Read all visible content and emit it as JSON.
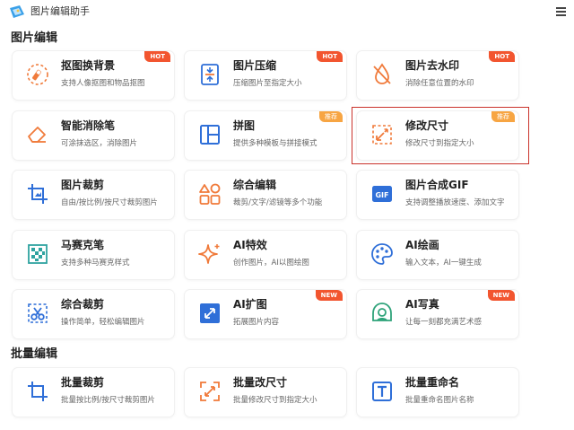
{
  "app": {
    "title": "图片编辑助手"
  },
  "sections": {
    "image_edit": "图片编辑",
    "batch_edit": "批量编辑"
  },
  "badges": {
    "hot": "HOT",
    "new": "NEW",
    "rec": "推荐"
  },
  "cards": {
    "cutout": {
      "title": "抠图换背景",
      "desc": "支持人像抠图和物品抠图"
    },
    "compress": {
      "title": "图片压缩",
      "desc": "压缩图片至指定大小"
    },
    "watermark": {
      "title": "图片去水印",
      "desc": "消除任意位置的水印"
    },
    "eraser": {
      "title": "智能消除笔",
      "desc": "可涂抹选区，消除图片"
    },
    "collage": {
      "title": "拼图",
      "desc": "提供多种模板与拼接模式"
    },
    "resize": {
      "title": "修改尺寸",
      "desc": "修改尺寸到指定大小"
    },
    "crop": {
      "title": "图片裁剪",
      "desc": "自由/按比例/按尺寸裁剪图片"
    },
    "combo": {
      "title": "综合编辑",
      "desc": "裁剪/文字/滤镜等多个功能"
    },
    "gif": {
      "title": "图片合成GIF",
      "desc": "支持调整播放速度、添加文字"
    },
    "mosaic": {
      "title": "马赛克笔",
      "desc": "支持多种马赛克样式"
    },
    "ai_effect": {
      "title": "AI特效",
      "desc": "创作图片，AI以图绘图"
    },
    "ai_paint": {
      "title": "AI绘画",
      "desc": "输入文本，AI一键生成"
    },
    "combo_crop": {
      "title": "综合裁剪",
      "desc": "操作简单，轻松编辑图片"
    },
    "ai_expand": {
      "title": "AI扩图",
      "desc": "拓展图片内容"
    },
    "ai_portrait": {
      "title": "AI写真",
      "desc": "让每一刻都充满艺术感"
    },
    "batch_crop": {
      "title": "批量裁剪",
      "desc": "批量按比例/按尺寸裁剪图片"
    },
    "batch_resize": {
      "title": "批量改尺寸",
      "desc": "批量修改尺寸到指定大小"
    },
    "batch_rename": {
      "title": "批量重命名",
      "desc": "批量重命名图片名称"
    }
  },
  "colors": {
    "accent": "#f2552f",
    "badge_rec": "#f7a543",
    "icon_blue": "#2f6fd8",
    "icon_orange": "#f07a3a",
    "highlight": "#c9322b"
  }
}
